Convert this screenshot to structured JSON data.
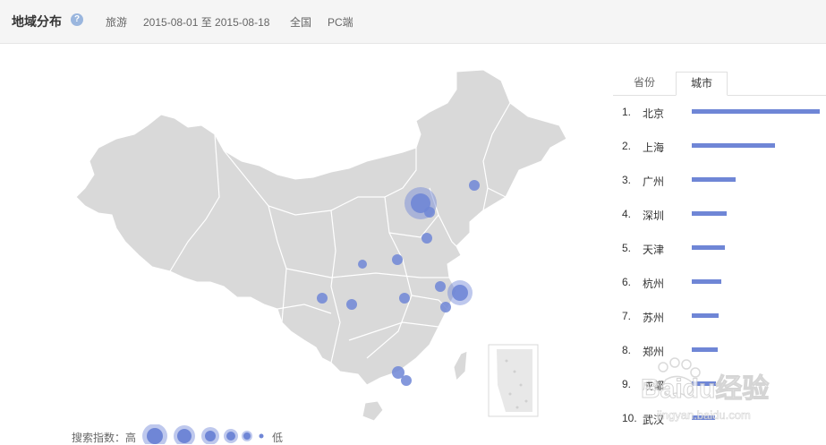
{
  "header": {
    "title": "地域分布",
    "help_icon": "?",
    "keyword": "旅游",
    "date_range": "2015-08-01 至 2015-08-18",
    "region": "全国",
    "platform": "PC端"
  },
  "colors": {
    "accent": "#6f86d6",
    "map_fill": "#d9d9d9",
    "bubble": "#6f86d6"
  },
  "legend": {
    "label": "搜索指数：高",
    "low_label": "低"
  },
  "tabs": [
    {
      "label": "省份",
      "active": false
    },
    {
      "label": "城市",
      "active": true
    }
  ],
  "ranking": [
    {
      "rank": "1.",
      "name": "北京",
      "value": 1.0
    },
    {
      "rank": "2.",
      "name": "上海",
      "value": 0.65
    },
    {
      "rank": "3.",
      "name": "广州",
      "value": 0.34
    },
    {
      "rank": "4.",
      "name": "深圳",
      "value": 0.27
    },
    {
      "rank": "5.",
      "name": "天津",
      "value": 0.26
    },
    {
      "rank": "6.",
      "name": "杭州",
      "value": 0.23
    },
    {
      "rank": "7.",
      "name": "苏州",
      "value": 0.21
    },
    {
      "rank": "8.",
      "name": "郑州",
      "value": 0.2
    },
    {
      "rank": "9.",
      "name": "成都",
      "value": 0.19
    },
    {
      "rank": "10.",
      "name": "武汉",
      "value": 0.18
    }
  ],
  "watermark": {
    "text": "Baidu经验",
    "url_text": "jingyan.baidu.com"
  }
}
